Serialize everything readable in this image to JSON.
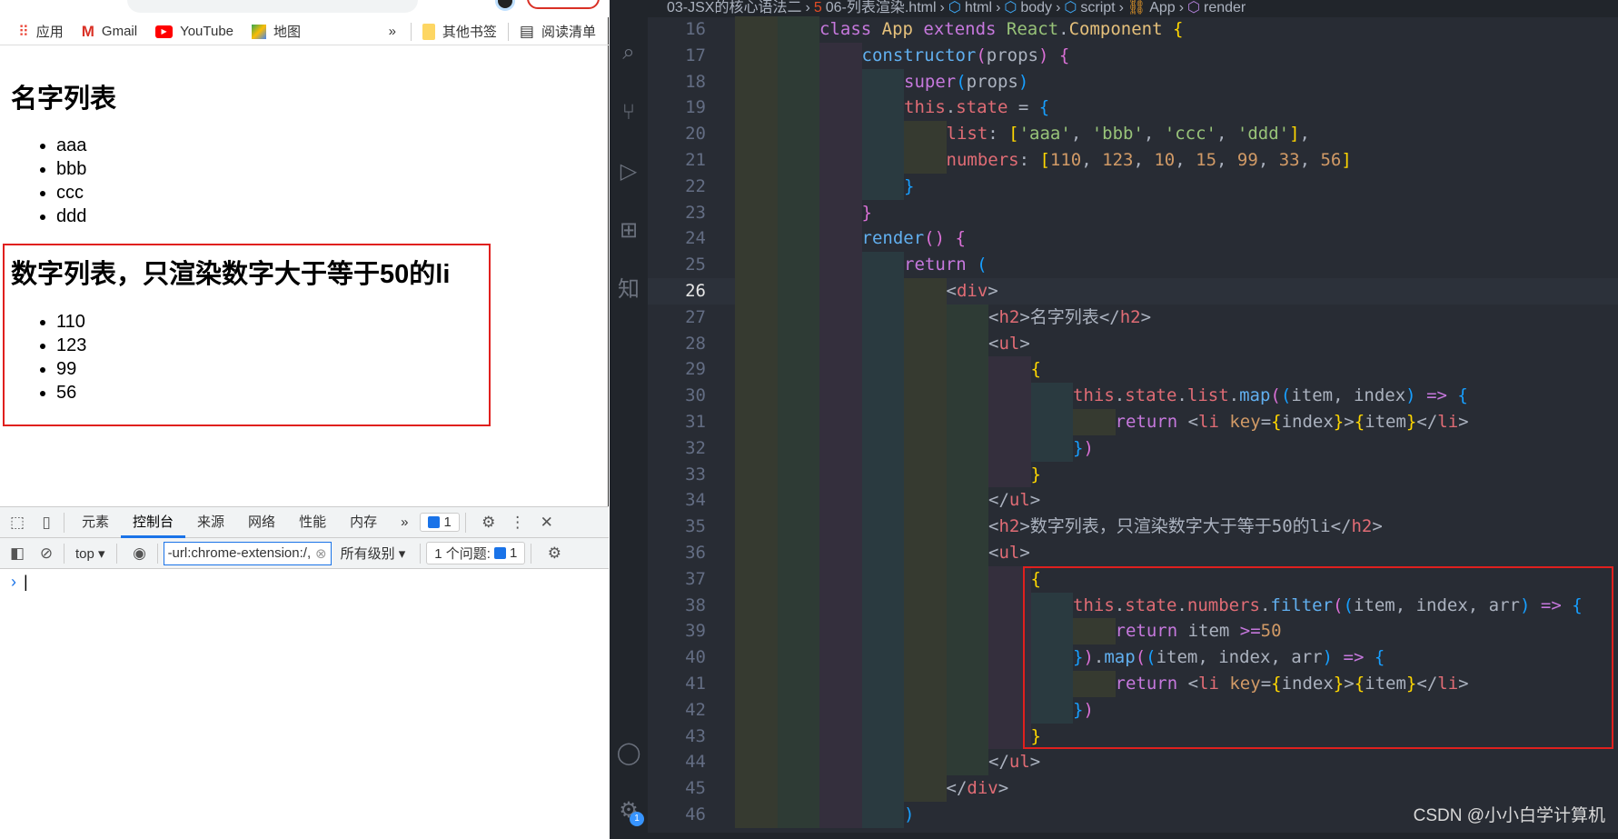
{
  "browser": {
    "bookmarks": [
      {
        "label": "应用",
        "icon": "apps-grid-icon"
      },
      {
        "label": "Gmail",
        "icon": "gmail-icon"
      },
      {
        "label": "YouTube",
        "icon": "youtube-icon"
      },
      {
        "label": "地图",
        "icon": "maps-icon"
      }
    ],
    "more": "»",
    "other_bookmarks": "其他书签",
    "reading_list": "阅读清单",
    "page": {
      "h2_names": "名字列表",
      "names": [
        "aaa",
        "bbb",
        "ccc",
        "ddd"
      ],
      "h2_numbers": "数字列表，只渲染数字大于等于50的li",
      "numbers": [
        "110",
        "123",
        "99",
        "56"
      ]
    },
    "devtools": {
      "tabs": [
        "元素",
        "控制台",
        "来源",
        "网络",
        "性能",
        "内存"
      ],
      "active_tab": "控制台",
      "more": "»",
      "messages_count": "1",
      "context": "top",
      "filter_value": "-url:chrome-extension:/,",
      "levels": "所有级别",
      "issues_label": "1 个问题:",
      "issues_count": "1",
      "prompt": "›"
    }
  },
  "editor": {
    "breadcrumb": [
      "03-JSX的核心语法二",
      "06-列表渲染.html",
      "html",
      "body",
      "script",
      "App",
      "render"
    ],
    "current_line": 26,
    "lines": [
      {
        "n": 16,
        "i": 2,
        "t": [
          [
            "class ",
            "kw"
          ],
          [
            "App ",
            "cls"
          ],
          [
            "extends ",
            "kw"
          ],
          [
            "React",
            "grn"
          ],
          [
            ".",
            ""
          ],
          [
            "Component ",
            "cls"
          ],
          [
            "{",
            "b1"
          ]
        ]
      },
      {
        "n": 17,
        "i": 3,
        "t": [
          [
            "constructor",
            "fn"
          ],
          [
            "(",
            "b2"
          ],
          [
            "props",
            ""
          ],
          [
            ")",
            "b2"
          ],
          [
            " ",
            ""
          ],
          [
            "{",
            "b2"
          ]
        ]
      },
      {
        "n": 18,
        "i": 4,
        "t": [
          [
            "super",
            "kw"
          ],
          [
            "(",
            "b3"
          ],
          [
            "props",
            ""
          ],
          [
            ")",
            "b3"
          ]
        ]
      },
      {
        "n": 19,
        "i": 4,
        "t": [
          [
            "this",
            "prop"
          ],
          [
            ".",
            ""
          ],
          [
            "state",
            "prop"
          ],
          [
            " = ",
            ""
          ],
          [
            "{",
            "b3"
          ]
        ]
      },
      {
        "n": 20,
        "i": 5,
        "t": [
          [
            "list",
            "prop"
          ],
          [
            ": ",
            ""
          ],
          [
            "[",
            "b1"
          ],
          [
            "'aaa'",
            "str"
          ],
          [
            ", ",
            ""
          ],
          [
            "'bbb'",
            "str"
          ],
          [
            ", ",
            ""
          ],
          [
            "'ccc'",
            "str"
          ],
          [
            ", ",
            ""
          ],
          [
            "'ddd'",
            "str"
          ],
          [
            "]",
            "b1"
          ],
          [
            ",",
            ""
          ]
        ]
      },
      {
        "n": 21,
        "i": 5,
        "t": [
          [
            "numbers",
            "prop"
          ],
          [
            ": ",
            ""
          ],
          [
            "[",
            "b1"
          ],
          [
            "110",
            "nm"
          ],
          [
            ", ",
            ""
          ],
          [
            "123",
            "nm"
          ],
          [
            ", ",
            ""
          ],
          [
            "10",
            "nm"
          ],
          [
            ", ",
            ""
          ],
          [
            "15",
            "nm"
          ],
          [
            ", ",
            ""
          ],
          [
            "99",
            "nm"
          ],
          [
            ", ",
            ""
          ],
          [
            "33",
            "nm"
          ],
          [
            ", ",
            ""
          ],
          [
            "56",
            "nm"
          ],
          [
            "]",
            "b1"
          ]
        ]
      },
      {
        "n": 22,
        "i": 4,
        "t": [
          [
            "}",
            "b3"
          ]
        ]
      },
      {
        "n": 23,
        "i": 3,
        "t": [
          [
            "}",
            "b2"
          ]
        ]
      },
      {
        "n": 24,
        "i": 3,
        "t": [
          [
            "render",
            "fn"
          ],
          [
            "(",
            "b2"
          ],
          [
            ")",
            "b2"
          ],
          [
            " ",
            ""
          ],
          [
            "{",
            "b2"
          ]
        ]
      },
      {
        "n": 25,
        "i": 4,
        "t": [
          [
            "return ",
            "kw"
          ],
          [
            "(",
            "b3"
          ]
        ]
      },
      {
        "n": 26,
        "i": 5,
        "t": [
          [
            "<",
            "ang"
          ],
          [
            "div",
            "tag"
          ],
          [
            ">",
            "ang"
          ]
        ]
      },
      {
        "n": 27,
        "i": 6,
        "t": [
          [
            "<",
            "ang"
          ],
          [
            "h2",
            "tag"
          ],
          [
            ">",
            "ang"
          ],
          [
            "名字列表",
            ""
          ],
          [
            "</",
            "ang"
          ],
          [
            "h2",
            "tag"
          ],
          [
            ">",
            "ang"
          ]
        ]
      },
      {
        "n": 28,
        "i": 6,
        "t": [
          [
            "<",
            "ang"
          ],
          [
            "ul",
            "tag"
          ],
          [
            ">",
            "ang"
          ]
        ]
      },
      {
        "n": 29,
        "i": 7,
        "t": [
          [
            "{",
            "b1"
          ]
        ]
      },
      {
        "n": 30,
        "i": 8,
        "t": [
          [
            "this",
            "prop"
          ],
          [
            ".",
            ""
          ],
          [
            "state",
            "prop"
          ],
          [
            ".",
            ""
          ],
          [
            "list",
            "prop"
          ],
          [
            ".",
            ""
          ],
          [
            "map",
            "fn"
          ],
          [
            "(",
            "b2"
          ],
          [
            "(",
            "b3"
          ],
          [
            "item, index",
            ""
          ],
          [
            ")",
            "b3"
          ],
          [
            " => ",
            "op"
          ],
          [
            "{",
            "b3"
          ]
        ]
      },
      {
        "n": 31,
        "i": 9,
        "t": [
          [
            "return ",
            "kw"
          ],
          [
            "<",
            "ang"
          ],
          [
            "li ",
            "tag"
          ],
          [
            "key",
            "attr"
          ],
          [
            "=",
            ""
          ],
          [
            "{",
            "b1"
          ],
          [
            "index",
            ""
          ],
          [
            "}",
            "b1"
          ],
          [
            ">",
            "ang"
          ],
          [
            "{",
            "b1"
          ],
          [
            "item",
            ""
          ],
          [
            "}",
            "b1"
          ],
          [
            "</",
            "ang"
          ],
          [
            "li",
            "tag"
          ],
          [
            ">",
            "ang"
          ]
        ]
      },
      {
        "n": 32,
        "i": 8,
        "t": [
          [
            "}",
            "b3"
          ],
          [
            ")",
            "b2"
          ]
        ]
      },
      {
        "n": 33,
        "i": 7,
        "t": [
          [
            "}",
            "b1"
          ]
        ]
      },
      {
        "n": 34,
        "i": 6,
        "t": [
          [
            "</",
            "ang"
          ],
          [
            "ul",
            "tag"
          ],
          [
            ">",
            "ang"
          ]
        ]
      },
      {
        "n": 35,
        "i": 6,
        "t": [
          [
            "<",
            "ang"
          ],
          [
            "h2",
            "tag"
          ],
          [
            ">",
            "ang"
          ],
          [
            "数字列表，只渲染数字大于等于50的li",
            ""
          ],
          [
            "</",
            "ang"
          ],
          [
            "h2",
            "tag"
          ],
          [
            ">",
            "ang"
          ]
        ]
      },
      {
        "n": 36,
        "i": 6,
        "t": [
          [
            "<",
            "ang"
          ],
          [
            "ul",
            "tag"
          ],
          [
            ">",
            "ang"
          ]
        ]
      },
      {
        "n": 37,
        "i": 7,
        "t": [
          [
            "{",
            "b1"
          ]
        ]
      },
      {
        "n": 38,
        "i": 8,
        "t": [
          [
            "this",
            "prop"
          ],
          [
            ".",
            ""
          ],
          [
            "state",
            "prop"
          ],
          [
            ".",
            ""
          ],
          [
            "numbers",
            "prop"
          ],
          [
            ".",
            ""
          ],
          [
            "filter",
            "fn"
          ],
          [
            "(",
            "b2"
          ],
          [
            "(",
            "b3"
          ],
          [
            "item, index, arr",
            ""
          ],
          [
            ")",
            "b3"
          ],
          [
            " => ",
            "op"
          ],
          [
            "{",
            "b3"
          ]
        ]
      },
      {
        "n": 39,
        "i": 9,
        "t": [
          [
            "return ",
            "kw"
          ],
          [
            "item ",
            ""
          ],
          [
            ">=",
            "op"
          ],
          [
            "50",
            "nm"
          ]
        ]
      },
      {
        "n": 40,
        "i": 8,
        "t": [
          [
            "}",
            "b3"
          ],
          [
            ")",
            "b2"
          ],
          [
            ".",
            ""
          ],
          [
            "map",
            "fn"
          ],
          [
            "(",
            "b2"
          ],
          [
            "(",
            "b3"
          ],
          [
            "item, index, arr",
            ""
          ],
          [
            ")",
            "b3"
          ],
          [
            " => ",
            "op"
          ],
          [
            "{",
            "b3"
          ]
        ]
      },
      {
        "n": 41,
        "i": 9,
        "t": [
          [
            "return ",
            "kw"
          ],
          [
            "<",
            "ang"
          ],
          [
            "li ",
            "tag"
          ],
          [
            "key",
            "attr"
          ],
          [
            "=",
            ""
          ],
          [
            "{",
            "b1"
          ],
          [
            "index",
            ""
          ],
          [
            "}",
            "b1"
          ],
          [
            ">",
            "ang"
          ],
          [
            "{",
            "b1"
          ],
          [
            "item",
            ""
          ],
          [
            "}",
            "b1"
          ],
          [
            "</",
            "ang"
          ],
          [
            "li",
            "tag"
          ],
          [
            ">",
            "ang"
          ]
        ]
      },
      {
        "n": 42,
        "i": 8,
        "t": [
          [
            "}",
            "b3"
          ],
          [
            ")",
            "b2"
          ]
        ]
      },
      {
        "n": 43,
        "i": 7,
        "t": [
          [
            "}",
            "b1"
          ]
        ]
      },
      {
        "n": 44,
        "i": 6,
        "t": [
          [
            "</",
            "ang"
          ],
          [
            "ul",
            "tag"
          ],
          [
            ">",
            "ang"
          ]
        ]
      },
      {
        "n": 45,
        "i": 5,
        "t": [
          [
            "</",
            "ang"
          ],
          [
            "div",
            "tag"
          ],
          [
            ">",
            "ang"
          ]
        ]
      },
      {
        "n": 46,
        "i": 4,
        "t": [
          [
            ")",
            "b3"
          ]
        ]
      }
    ],
    "activity_icons": [
      "search-icon",
      "source-control-icon",
      "run-debug-icon",
      "extensions-icon",
      "zhihu-icon",
      "account-icon",
      "settings-gear-icon"
    ],
    "settings_badge": "1",
    "watermark": "CSDN @小小白学计算机"
  }
}
